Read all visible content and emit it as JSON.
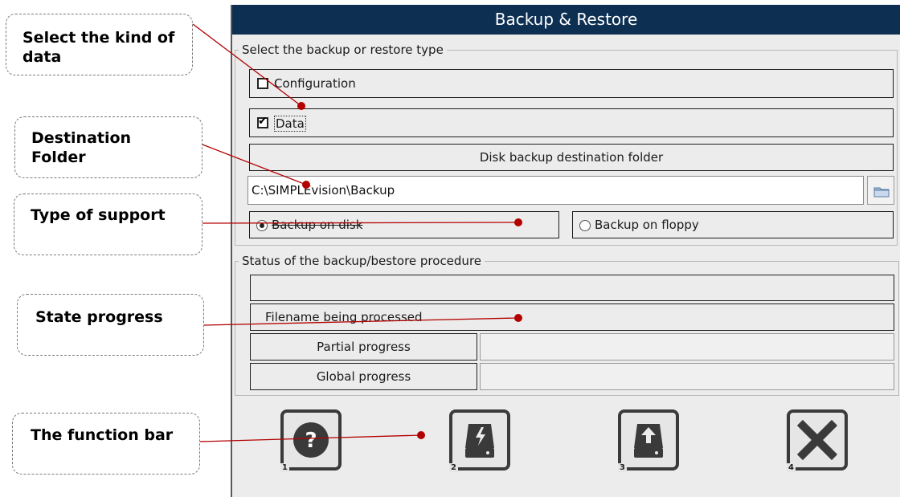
{
  "window": {
    "title": "Backup & Restore"
  },
  "type_group": {
    "legend": "Select the backup or restore type",
    "configuration_label": "Configuration",
    "configuration_checked": false,
    "data_label": "Data",
    "data_checked": true,
    "dest_header": "Disk backup destination folder",
    "dest_path": "C:\\SIMPLEvision\\Backup",
    "browse_icon": "folder-icon",
    "radio_disk_label": "Backup on disk",
    "radio_floppy_label": "Backup on floppy",
    "selected_support": "Backup on disk"
  },
  "status_group": {
    "legend": "Status of the backup/bestore procedure",
    "status_text": "",
    "filename_label": "Filename being processed",
    "partial_label": "Partial progress",
    "partial_value": "",
    "global_label": "Global progress",
    "global_value": ""
  },
  "function_bar": [
    {
      "number": "1",
      "icon": "help-icon"
    },
    {
      "number": "2",
      "icon": "backup-drive-icon"
    },
    {
      "number": "3",
      "icon": "restore-drive-icon"
    },
    {
      "number": "4",
      "icon": "close-icon"
    }
  ],
  "callouts": {
    "kind_of_data": "Select the kind of data",
    "destination_folder": "Destination Folder",
    "type_of_support": "Type of support",
    "state_progress": "State progress",
    "function_bar": "The function bar"
  },
  "colors": {
    "titlebar": "#0d2f52",
    "annotation_line": "#b30000"
  }
}
